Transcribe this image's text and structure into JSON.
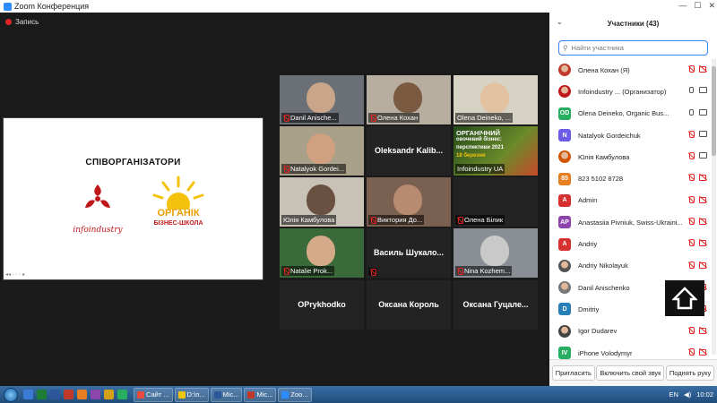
{
  "window": {
    "title": "Zoom Конференция",
    "minimize": "—",
    "maximize": "☐",
    "close": "✕"
  },
  "recording": {
    "label": "Запись"
  },
  "shared_slide": {
    "heading": "СПІВОРГАНІЗАТОРИ",
    "logo_left_text": "infoindustry",
    "logo_right_line1": "ОРГАНІК",
    "logo_right_line2": "БІЗНЕС-ШКОЛА",
    "toolbar": "◂◂ ◦ ◦ ◦ ▸"
  },
  "video_tiles": [
    {
      "name": "Danil Anische...",
      "muted": true,
      "type": "video",
      "bg": "#6b6f76",
      "face": "#c9a58a"
    },
    {
      "name": "Олена Кохан",
      "muted": true,
      "type": "video",
      "bg": "#b7aea0",
      "face": "#7a5a40"
    },
    {
      "name": "Olena Deineko, ...",
      "muted": false,
      "type": "video",
      "bg": "#d7d3c4",
      "face": "#e2c2a0",
      "highlight": true
    },
    {
      "name": "Natalyok Gordei...",
      "muted": true,
      "type": "video",
      "bg": "#a8a089",
      "face": "#d0a080"
    },
    {
      "name": "Oleksandr  Kalib...",
      "muted": false,
      "type": "name"
    },
    {
      "name": "Infoindustry UA",
      "muted": false,
      "type": "poster",
      "poster_lines": [
        "ОРГАНІЧНИЙ",
        "овочевий бізнес:",
        "перспективи 2021",
        "18 березня"
      ]
    },
    {
      "name": "Юлія Камбулова",
      "muted": false,
      "type": "video",
      "bg": "#c8c2b6",
      "face": "#6a5040"
    },
    {
      "name": "Виктория До...",
      "muted": true,
      "type": "video",
      "bg": "#7a6050",
      "face": "#b88a70"
    },
    {
      "name": "Олена Білик",
      "muted": true,
      "type": "empty"
    },
    {
      "name": "Natalie Prok...",
      "muted": true,
      "type": "video",
      "bg": "#3a6a3a",
      "face": "#d4aa88"
    },
    {
      "name": "Василь  Шукало...",
      "muted": true,
      "type": "name"
    },
    {
      "name": "Nina Kozhem...",
      "muted": true,
      "type": "video",
      "bg": "#8a8f96",
      "face": "#c9c9c9"
    },
    {
      "name": "OPrykhodko",
      "muted": false,
      "type": "name"
    },
    {
      "name": "Оксана Король",
      "muted": false,
      "type": "name"
    },
    {
      "name": "Оксана  Гуцале...",
      "muted": false,
      "type": "name"
    }
  ],
  "participants_panel": {
    "title": "Участники (43)",
    "search_placeholder": "Найти участника",
    "participants": [
      {
        "name": "Олена Кохан (Я)",
        "initials": "",
        "color": "#c0392b",
        "photo": true,
        "mic": "off",
        "cam": "off"
      },
      {
        "name": "Infoindustry ... (Организатор)",
        "initials": "",
        "color": "#c0171b",
        "photo": true,
        "mic": "on",
        "cam": "on"
      },
      {
        "name": "Olena Deineko, Organic Bus...",
        "initials": "OD",
        "color": "#27ae60",
        "photo": false,
        "mic": "on",
        "cam": "on"
      },
      {
        "name": "Natalyok Gordeichuk",
        "initials": "N",
        "color": "#6c5ce7",
        "photo": false,
        "mic": "off",
        "cam": "on"
      },
      {
        "name": "Юлія Камбулова",
        "initials": "",
        "color": "#d35400",
        "photo": true,
        "mic": "off",
        "cam": "on"
      },
      {
        "name": "823 5102 8728",
        "initials": "85",
        "color": "#e67e22",
        "photo": false,
        "mic": "off",
        "cam": "off"
      },
      {
        "name": "Admin",
        "initials": "A",
        "color": "#d63031",
        "photo": false,
        "mic": "off",
        "cam": "off"
      },
      {
        "name": "Anastasiia Pivniuk, Swiss-Ukraini...",
        "initials": "AP",
        "color": "#8e44ad",
        "photo": false,
        "mic": "off",
        "cam": "off"
      },
      {
        "name": "Andriy",
        "initials": "A",
        "color": "#d63031",
        "photo": false,
        "mic": "off",
        "cam": "off"
      },
      {
        "name": "Andriy Nikolayuk",
        "initials": "",
        "color": "#555",
        "photo": true,
        "mic": "off",
        "cam": "off"
      },
      {
        "name": "Danil Anischenko",
        "initials": "",
        "color": "#777",
        "photo": true,
        "mic": "off",
        "cam": "off"
      },
      {
        "name": "Dmitriy",
        "initials": "D",
        "color": "#2980b9",
        "photo": false,
        "mic": "off",
        "cam": "off"
      },
      {
        "name": "Igor Dudarev",
        "initials": "",
        "color": "#444",
        "photo": true,
        "mic": "off",
        "cam": "off"
      },
      {
        "name": "iPhone Volodymyr",
        "initials": "IV",
        "color": "#27ae60",
        "photo": false,
        "mic": "off",
        "cam": "off"
      }
    ],
    "footer": {
      "invite": "Пригласить",
      "unmute": "Включить свой звук",
      "raise_hand": "Поднять руку"
    }
  },
  "taskbar": {
    "buttons": [
      {
        "label": "Сайт ...",
        "color": "#e74c3c"
      },
      {
        "label": "D:\\п...",
        "color": "#f1c40f"
      },
      {
        "label": "Mic...",
        "color": "#2b579a"
      },
      {
        "label": "Mic...",
        "color": "#c0392b"
      },
      {
        "label": "Zoo...",
        "color": "#2d8cff"
      }
    ],
    "language": "EN",
    "clock": "10:02"
  }
}
